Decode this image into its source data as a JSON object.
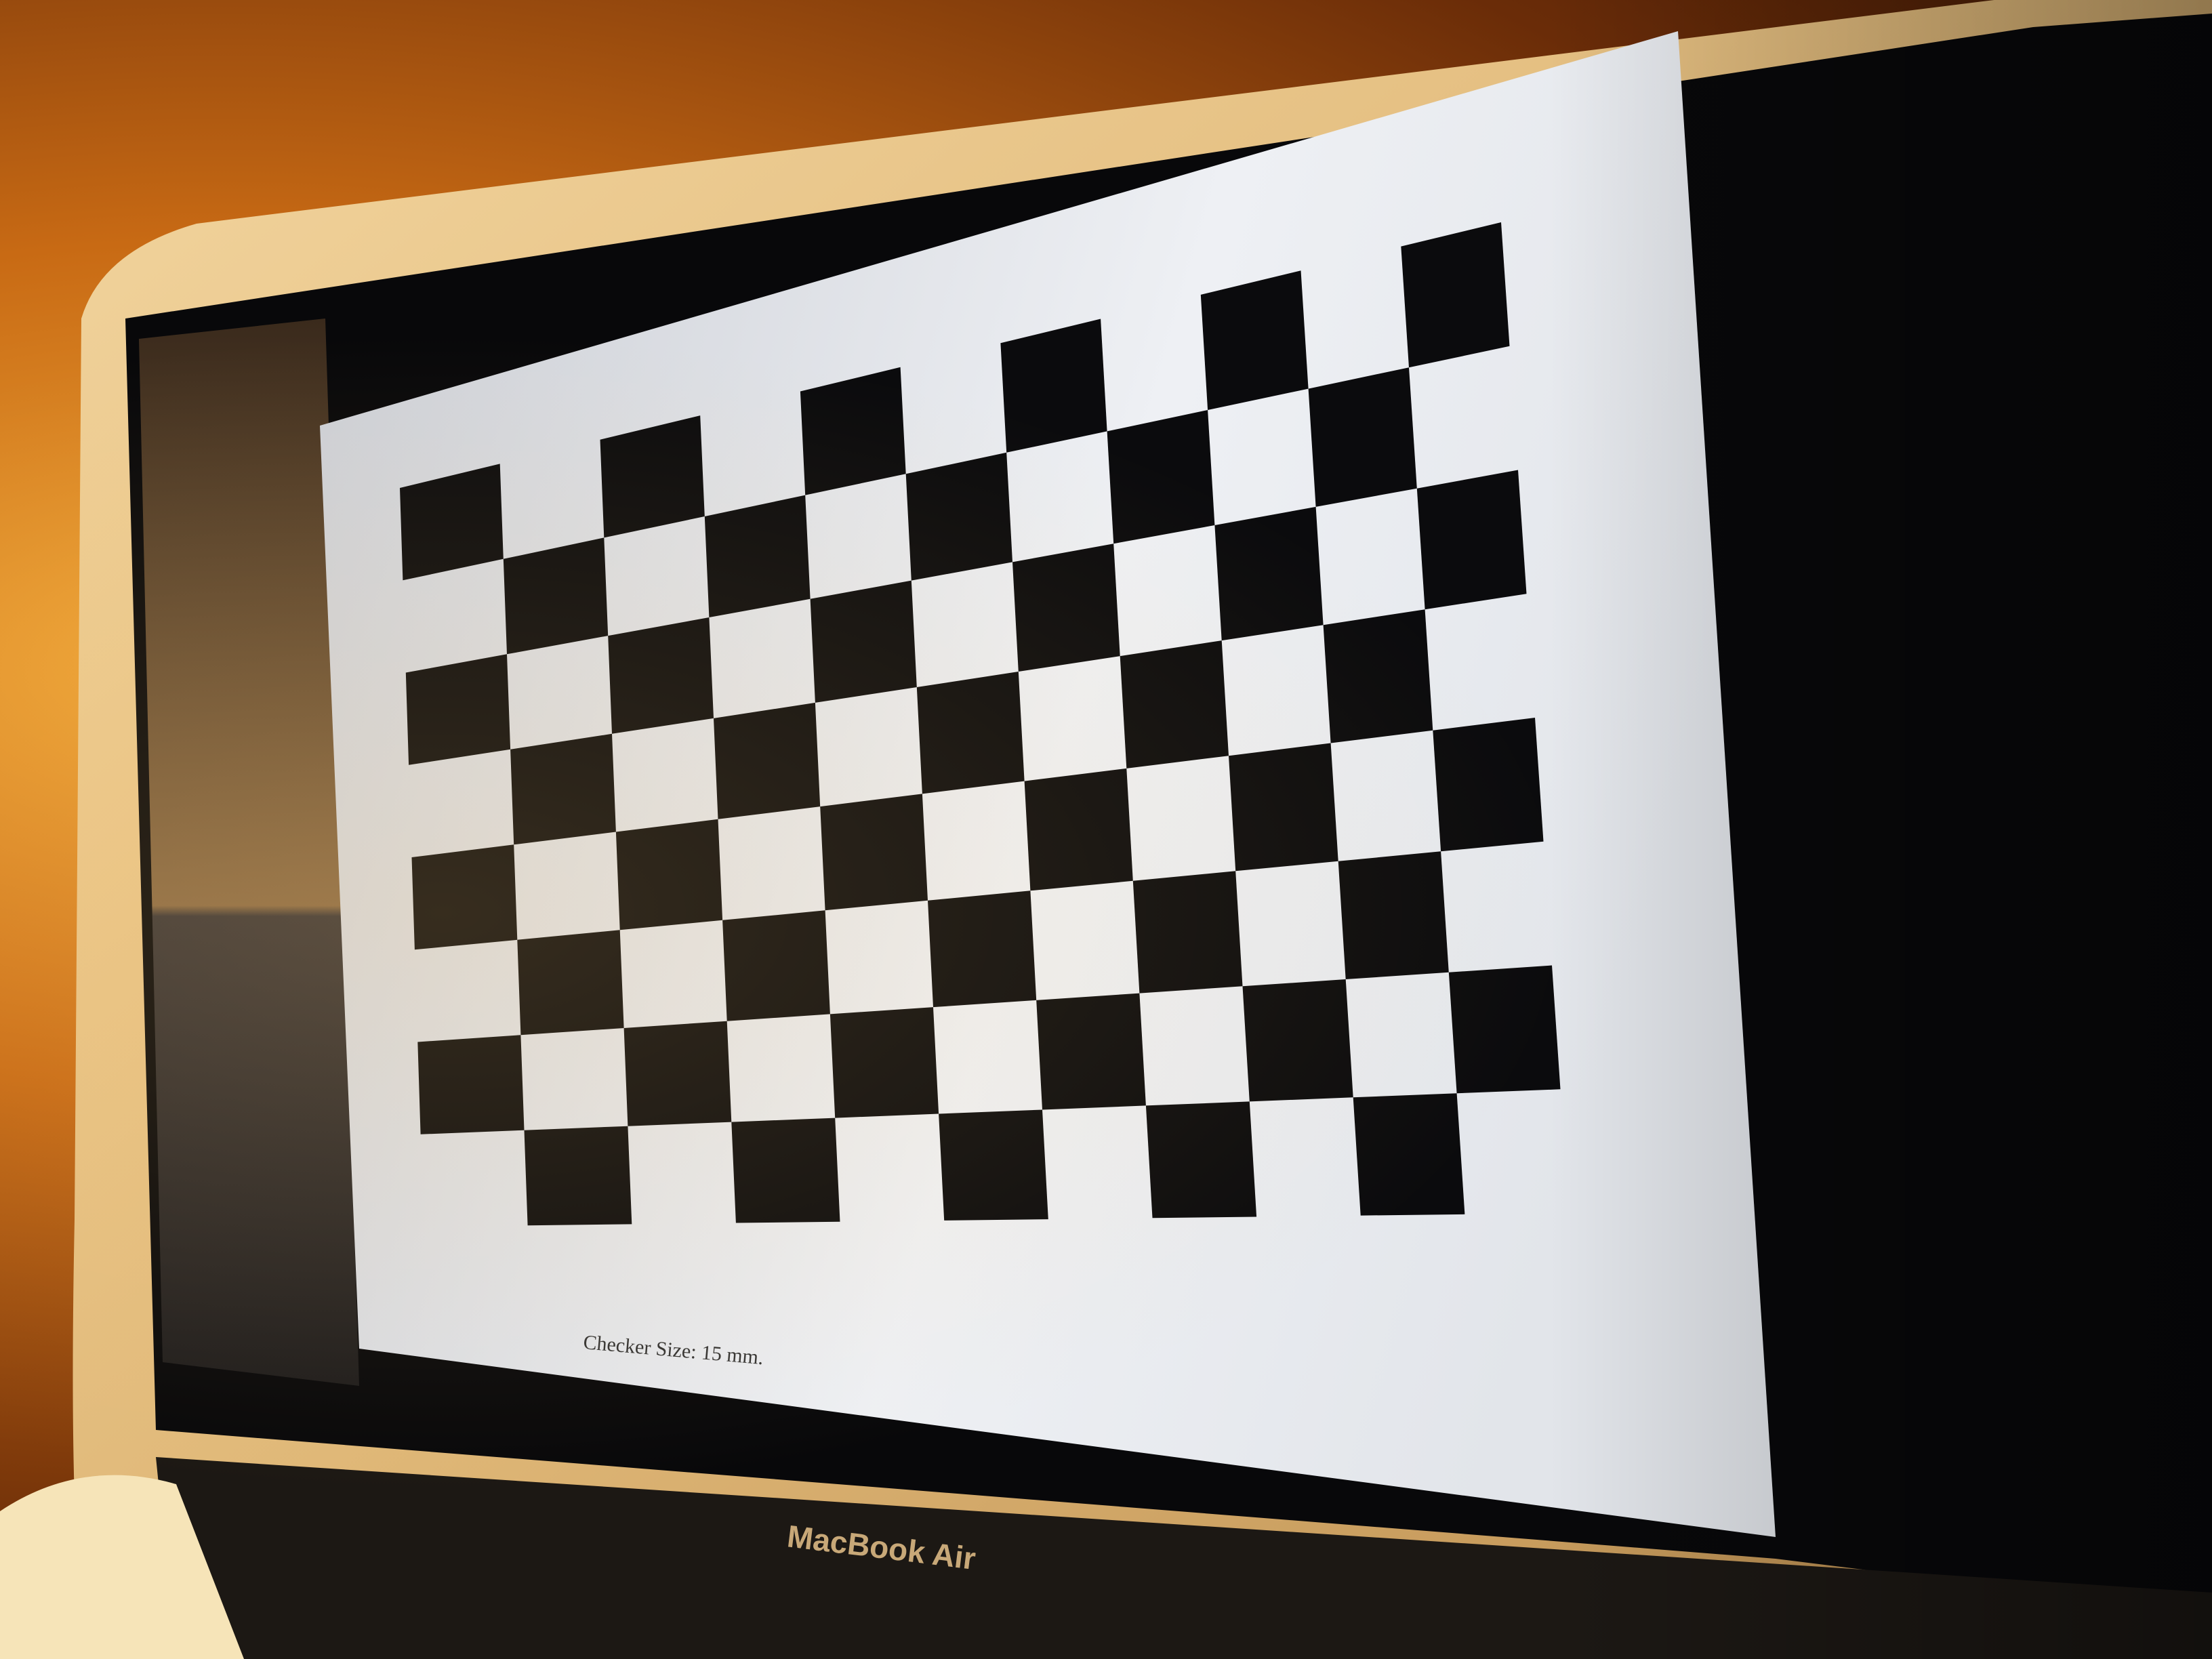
{
  "board": {
    "cols": 11,
    "rows": 8,
    "caption": "Checker Size: 15 mm."
  },
  "laptop": {
    "brand_label": "MacBook Air"
  },
  "colors": {
    "bezel": "#0a0a0c",
    "shell": "#e8c890",
    "paper": "#dfe2e8",
    "square": "#0b0b0d"
  }
}
